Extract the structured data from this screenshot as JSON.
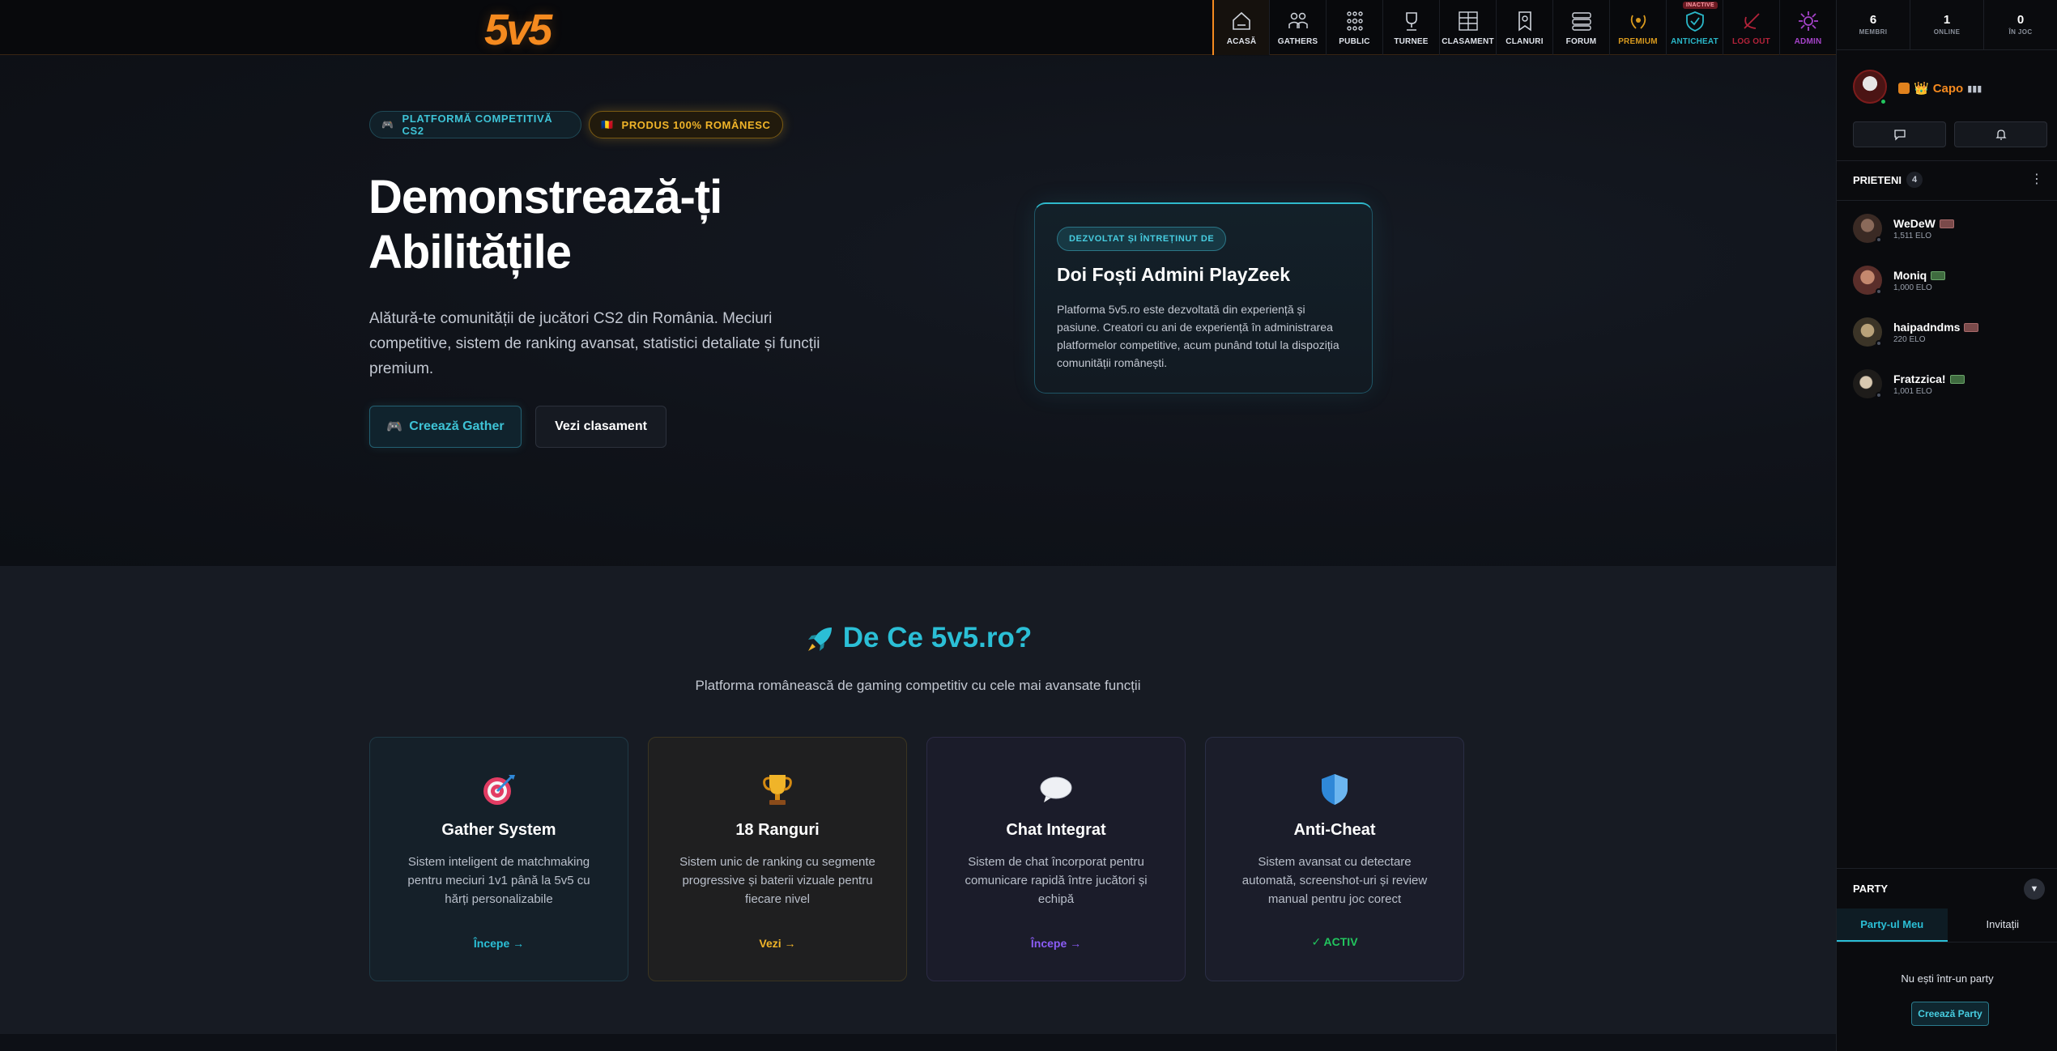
{
  "brand": {
    "logo_text": "5v5",
    "accent": "#f58a1f"
  },
  "nav": [
    {
      "label": "ACASĂ",
      "icon": "home-icon",
      "active": true
    },
    {
      "label": "GATHERS",
      "icon": "players-icon"
    },
    {
      "label": "PUBLIC",
      "icon": "network-icon"
    },
    {
      "label": "TURNEE",
      "icon": "trophy-icon"
    },
    {
      "label": "CLASAMENT",
      "icon": "ranking-icon"
    },
    {
      "label": "CLANURI",
      "icon": "clan-banner-icon"
    },
    {
      "label": "FORUM",
      "icon": "forum-icon"
    },
    {
      "label": "PREMIUM",
      "icon": "laurel-icon"
    },
    {
      "label": "ANTICHEAT",
      "icon": "shield-check-icon",
      "badge": "INACTIVE"
    },
    {
      "label": "LOG OUT",
      "icon": "logout-icon"
    },
    {
      "label": "ADMIN",
      "icon": "admin-gear-icon"
    }
  ],
  "hero": {
    "pill_cs2": "PLATFORMĂ COMPETITIVĂ CS2",
    "pill_ro": "PRODUS 100% ROMÂNESC",
    "title_line1": "Demonstrează-ți",
    "title_line2": "Abilitățile",
    "subtitle": "Alătură-te comunității de jucători CS2 din România. Meciuri competitive, sistem de ranking avansat, statistici detaliate și funcții premium.",
    "btn_gather": "Creează Gather",
    "btn_ranking": "Vezi clasament"
  },
  "dev_card": {
    "tag": "DEZVOLTAT ȘI ÎNTREȚINUT DE",
    "title": "Doi Foști Admini PlayZeek",
    "text": "Platforma 5v5.ro este dezvoltată din experiență și pasiune. Creatori cu ani de experiență în administrarea platformelor competitive, acum punând totul la dispoziția comunității românești."
  },
  "features": {
    "title": "De Ce 5v5.ro?",
    "subtitle": "Platforma românească de gaming competitiv cu cele mai avansate funcții",
    "cards": [
      {
        "icon": "target-icon",
        "title": "Gather System",
        "desc": "Sistem inteligent de matchmaking pentru meciuri 1v1 până la 5v5 cu hărți personalizabile",
        "link": "Începe →"
      },
      {
        "icon": "trophy-icon",
        "title": "18 Ranguri",
        "desc": "Sistem unic de ranking cu segmente progressive și baterii vizuale pentru fiecare nivel",
        "link": "Vezi →"
      },
      {
        "icon": "chat-bubble-icon",
        "title": "Chat Integrat",
        "desc": "Sistem de chat încorporat pentru comunicare rapidă între jucători și echipă",
        "link": "Începe →"
      },
      {
        "icon": "shield-icon",
        "title": "Anti-Cheat",
        "desc": "Sistem avansat cu detectare automată, screenshot-uri și review manual pentru joc corect",
        "link": "✓ ACTIV"
      }
    ]
  },
  "sidebar": {
    "stats": [
      {
        "value": "6",
        "label": "MEMBRI"
      },
      {
        "value": "1",
        "label": "ONLINE"
      },
      {
        "value": "0",
        "label": "ÎN JOC"
      }
    ],
    "me": {
      "name": "Capo"
    },
    "friends_title": "PRIETENI",
    "friends_count": "4",
    "friends": [
      {
        "name": "WeDeW",
        "elo": "1,511 ELO",
        "tag": "red"
      },
      {
        "name": "Moniq",
        "elo": "1,000 ELO",
        "tag": "green"
      },
      {
        "name": "haipadndms",
        "elo": "220 ELO",
        "tag": "red"
      },
      {
        "name": "Fratzzica!",
        "elo": "1,001 ELO",
        "tag": "green"
      }
    ],
    "party_title": "PARTY",
    "party_tabs": [
      "Party-ul Meu",
      "Invitații"
    ],
    "party_empty": "Nu ești într-un party",
    "party_create": "Creează Party"
  }
}
